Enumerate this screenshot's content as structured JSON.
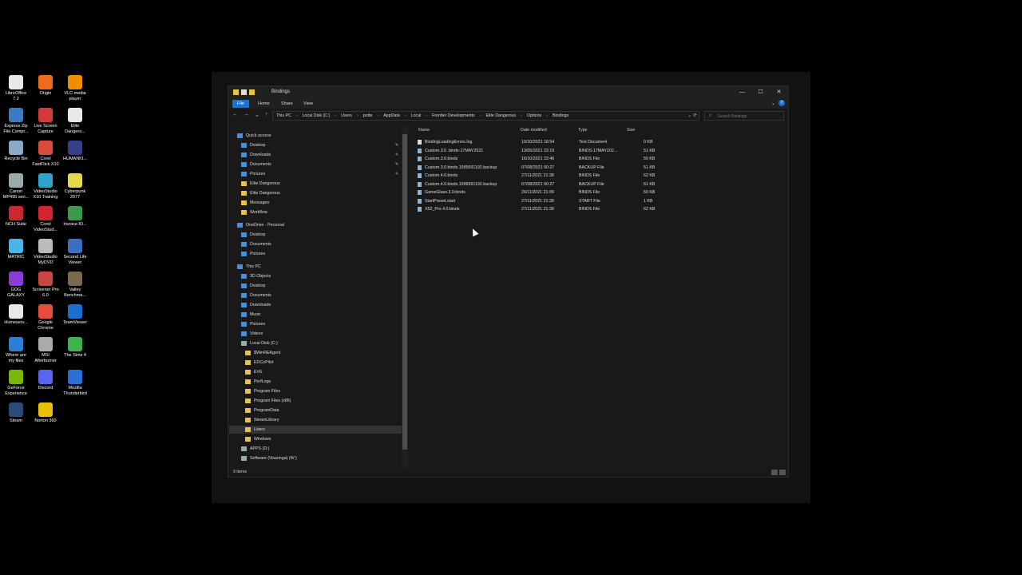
{
  "desktop": {
    "icons": [
      {
        "label": "LibreOffice\n7.2",
        "color": "#e8e8e8"
      },
      {
        "label": "Origin",
        "color": "#f06a1c"
      },
      {
        "label": "VLC media\nplayer",
        "color": "#f08c00"
      },
      {
        "label": "Express Zip\nFile Compr...",
        "color": "#3d7ac4"
      },
      {
        "label": "Live Screen\nCapture",
        "color": "#d23b3b"
      },
      {
        "label": "Elite\nDangero...",
        "color": "#e8e8e8"
      },
      {
        "label": "Recycle Bin",
        "color": "#8aa8c8"
      },
      {
        "label": "Corel\nFastFlick X10",
        "color": "#d94b3a"
      },
      {
        "label": "HUMANKI...",
        "color": "#33408a"
      },
      {
        "label": "Canon\nMP495 seri...",
        "color": "#9aa"
      },
      {
        "label": "VideoStudio\nX10 Training",
        "color": "#2fa3c9"
      },
      {
        "label": "Cyberpunk\n2077",
        "color": "#e6d84a"
      },
      {
        "label": "NCH Suite",
        "color": "#c9282d"
      },
      {
        "label": "Corel\nVideoStud...",
        "color": "#d0252e"
      },
      {
        "label": "Invoice-ID...",
        "color": "#3b9a4a"
      },
      {
        "label": "MATRIC",
        "color": "#49b5e8"
      },
      {
        "label": "VideoStudio\nMyDVD",
        "color": "#bbbbbb"
      },
      {
        "label": "Second Life\nViewer",
        "color": "#3a6fc4"
      },
      {
        "label": "GOG\nGALAXY",
        "color": "#8a3cd6"
      },
      {
        "label": "Scrivener Pro\n6.0",
        "color": "#c44"
      },
      {
        "label": "Valley\nBenchma...",
        "color": "#7a6a4a"
      },
      {
        "label": "Homeserv...",
        "color": "#e8e8e8"
      },
      {
        "label": "Google\nChrome",
        "color": "#e84c3d"
      },
      {
        "label": "TeamViewer",
        "color": "#1b6fd1"
      },
      {
        "label": "Where are\nmy files",
        "color": "#2b7fd4"
      },
      {
        "label": "MSI\nAfterburner",
        "color": "#aaa"
      },
      {
        "label": "The Sims 4",
        "color": "#3cb44a"
      },
      {
        "label": "GeForce\nExperience",
        "color": "#76b900"
      },
      {
        "label": "Discord",
        "color": "#5865f2"
      },
      {
        "label": "Mozilla\nThunderbird",
        "color": "#2a6fd6"
      },
      {
        "label": "Steam",
        "color": "#2a4a7a"
      },
      {
        "label": "Norton 360",
        "color": "#e8c200"
      }
    ]
  },
  "window": {
    "title": "Bindings",
    "controls": {
      "minimize": "—",
      "maximize": "☐",
      "close": "✕"
    },
    "ribbon": {
      "file": "File",
      "home": "Home",
      "share": "Share",
      "view": "View",
      "help": "?"
    },
    "nav": {
      "back": "←",
      "forward": "→",
      "recent": "⌄",
      "up": "↑"
    },
    "breadcrumbs": [
      "This PC",
      "Local Disk (C:)",
      "Users",
      "potte",
      "AppData",
      "Local",
      "Frontier Developments",
      "Elite Dangerous",
      "Options",
      "Bindings"
    ],
    "search_placeholder": "Search Bindings",
    "columns": {
      "name": "Name",
      "date": "Date modified",
      "type": "Type",
      "size": "Size"
    },
    "files": [
      {
        "name": "BindingLoadingErrors.log",
        "date": "10/10/2021 18:54",
        "type": "Text Document",
        "size": "0 KB"
      },
      {
        "name": "Custom.3.0 .binds-17MAY2021",
        "date": "13/05/2021 22:19",
        "type": "BINDS-17MAY202...",
        "size": "51 KB"
      },
      {
        "name": "Custom.3.0.binds",
        "date": "16/10/2021 22:46",
        "type": "BINDS File",
        "size": "50 KB"
      },
      {
        "name": "Custom.3.0.binds.1995691192.backup",
        "date": "07/08/2021 00:27",
        "type": "BACKUP File",
        "size": "51 KB"
      },
      {
        "name": "Custom.4.0.binds",
        "date": "27/11/2021 21:38",
        "type": "BINDS File",
        "size": "62 KB"
      },
      {
        "name": "Custom.4.0.binds.1995691192.backup",
        "date": "07/08/2021 00:27",
        "type": "BACKUP File",
        "size": "61 KB"
      },
      {
        "name": "GameGlass.3.0.binds",
        "date": "26/11/2021 21:09",
        "type": "BINDS File",
        "size": "50 KB"
      },
      {
        "name": "StartPreset.start",
        "date": "27/11/2021 21:39",
        "type": "START File",
        "size": "1 KB"
      },
      {
        "name": "X52_Pro.4.0.binds",
        "date": "27/11/2021 21:39",
        "type": "BINDS File",
        "size": "62 KB"
      }
    ],
    "navpane": [
      {
        "label": "Quick access",
        "indent": 0,
        "pinned": false
      },
      {
        "label": "Desktop",
        "indent": 1,
        "pinned": true
      },
      {
        "label": "Downloads",
        "indent": 1,
        "pinned": true
      },
      {
        "label": "Documents",
        "indent": 1,
        "pinned": true
      },
      {
        "label": "Pictures",
        "indent": 1,
        "pinned": true
      },
      {
        "label": "Elite Dangerous",
        "indent": 1,
        "pinned": false
      },
      {
        "label": "Elite Dangerous",
        "indent": 1,
        "pinned": false
      },
      {
        "label": "Messages",
        "indent": 1,
        "pinned": false
      },
      {
        "label": "Workflow",
        "indent": 1,
        "pinned": false
      },
      {
        "label": "OneDrive - Personal",
        "indent": 0,
        "pinned": false
      },
      {
        "label": "Desktop",
        "indent": 1,
        "pinned": false
      },
      {
        "label": "Documents",
        "indent": 1,
        "pinned": false
      },
      {
        "label": "Pictures",
        "indent": 1,
        "pinned": false
      },
      {
        "label": "This PC",
        "indent": 0,
        "pinned": false
      },
      {
        "label": "3D Objects",
        "indent": 1,
        "pinned": false
      },
      {
        "label": "Desktop",
        "indent": 1,
        "pinned": false
      },
      {
        "label": "Documents",
        "indent": 1,
        "pinned": false
      },
      {
        "label": "Downloads",
        "indent": 1,
        "pinned": false
      },
      {
        "label": "Music",
        "indent": 1,
        "pinned": false
      },
      {
        "label": "Pictures",
        "indent": 1,
        "pinned": false
      },
      {
        "label": "Videos",
        "indent": 1,
        "pinned": false
      },
      {
        "label": "Local Disk (C:)",
        "indent": 1,
        "pinned": false
      },
      {
        "label": "$WinREAgent",
        "indent": 2,
        "pinned": false
      },
      {
        "label": "EDCoPilot",
        "indent": 2,
        "pinned": false
      },
      {
        "label": "EVE",
        "indent": 2,
        "pinned": false
      },
      {
        "label": "PerfLogs",
        "indent": 2,
        "pinned": false
      },
      {
        "label": "Program Files",
        "indent": 2,
        "pinned": false
      },
      {
        "label": "Program Files (x86)",
        "indent": 2,
        "pinned": false
      },
      {
        "label": "ProgramData",
        "indent": 2,
        "pinned": false
      },
      {
        "label": "SteamLibrary",
        "indent": 2,
        "pinned": false
      },
      {
        "label": "Users",
        "indent": 2,
        "pinned": false,
        "selected": true
      },
      {
        "label": "Windows",
        "indent": 2,
        "pinned": false
      },
      {
        "label": "APPS (D:)",
        "indent": 1,
        "pinned": false
      },
      {
        "label": "Software (\\\\bazinga) (W:)",
        "indent": 1,
        "pinned": false
      }
    ],
    "status": "9 items"
  }
}
